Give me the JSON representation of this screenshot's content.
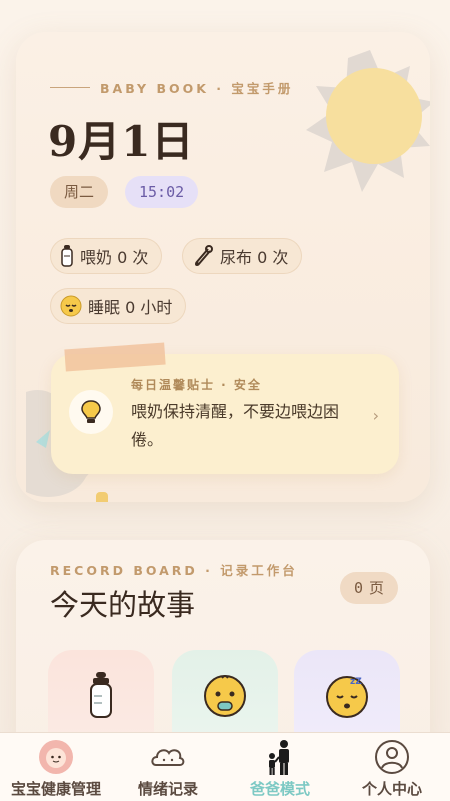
{
  "hero": {
    "eyebrow": "BABY BOOK · 宝宝手册",
    "date": "9月1日",
    "weekday": "周二",
    "time": "15:02",
    "stats": {
      "feed": "喂奶 0 次",
      "diaper": "尿布 0 次",
      "sleep": "睡眠 0 小时"
    }
  },
  "tip": {
    "heading": "每日温馨贴士 · 安全",
    "text": "喂奶保持清醒，不要边喂边困倦。",
    "chevron": "›"
  },
  "board": {
    "eyebrow": "RECORD BOARD · 记录工作台",
    "title": "今天的故事",
    "page_count": "0",
    "page_unit": "页"
  },
  "tabs": [
    {
      "label": "宝宝健康管理",
      "icon": "baby-avatar-icon",
      "active": false
    },
    {
      "label": "情绪记录",
      "icon": "cloud-face-icon",
      "active": false
    },
    {
      "label": "爸爸模式",
      "icon": "father-child-icon",
      "active": true
    },
    {
      "label": "个人中心",
      "icon": "user-profile-icon",
      "active": false
    }
  ],
  "colors": {
    "accent_active_tab": "#7dc9c4",
    "eyebrow": "#c29a6c",
    "tip_background": "#fcefcf"
  }
}
